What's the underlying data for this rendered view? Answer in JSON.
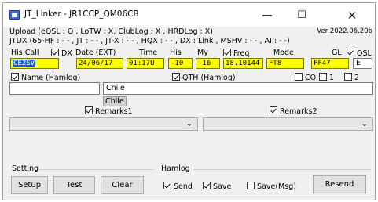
{
  "window": {
    "title": "JT_Linker - JR1CCP_QM06CB",
    "minimize_glyph": "—",
    "maximize_glyph": "☐",
    "close_glyph": "✕"
  },
  "status": {
    "upload_line": "Upload (eQSL : O , LoTW : X, ClubLog : X , HRDLog : X)",
    "version": "Ver 2022.06.20b",
    "jtdx_line": "JTDX (65-HF : - - , JT : - - , JT-X : - - , HQX : - - , DX : Link , MSHV : - - , AI : - -)"
  },
  "qso_headers": {
    "his_call": "His Call",
    "dx": "DX",
    "date": "Date (EXT)",
    "time": "Time",
    "his": "His",
    "my": "My",
    "freq": "Freq",
    "mode": "Mode",
    "gl": "GL",
    "qsl": "QSL"
  },
  "qso_values": {
    "his_call": "CE2SV",
    "date": "24/06/17",
    "time": "01:17U",
    "his": "-10",
    "my": "-16",
    "freq": "18.10144",
    "mode": "FT8",
    "gl": "FF47",
    "qsl": "E"
  },
  "checkboxes": {
    "dx": true,
    "freq": true,
    "qsl": true,
    "name_hamlog": true,
    "qth_hamlog": true,
    "cq": false,
    "one": false,
    "two": false,
    "remarks1": true,
    "remarks2": true,
    "send": true,
    "save": true,
    "save_msg": false
  },
  "labels": {
    "name_hamlog": "Name (Hamlog)",
    "qth_hamlog": "QTH (Hamlog)",
    "cq": "CQ",
    "one": "1",
    "two": "2",
    "remarks1": "Remarks1",
    "remarks2": "Remarks2",
    "setting": "Setting",
    "hamlog": "Hamlog",
    "send": "Send",
    "save": "Save",
    "save_msg": "Save(Msg)"
  },
  "fields": {
    "name_value": "",
    "qth_value": "Chile",
    "qth_suggest": "Chile",
    "remarks1_value": "",
    "remarks2_value": ""
  },
  "buttons": {
    "setup": "Setup",
    "test": "Test",
    "clear": "Clear",
    "resend": "Resend"
  }
}
